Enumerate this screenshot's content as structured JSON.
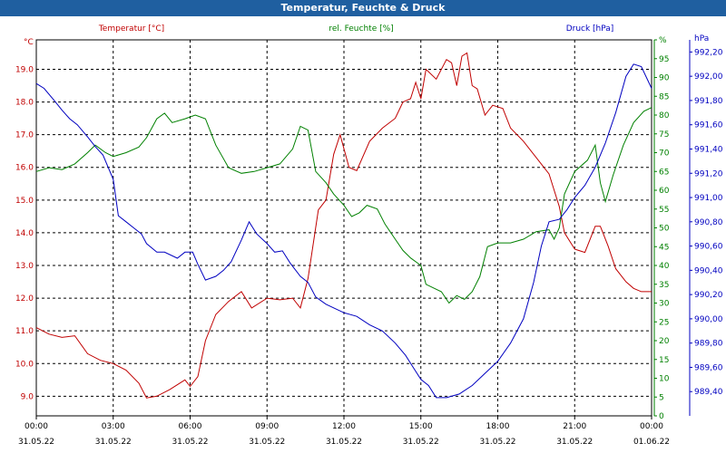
{
  "window": {
    "title": "Temperatur, Feuchte & Druck"
  },
  "colors": {
    "temperature": "#c00000",
    "humidity": "#008000",
    "pressure": "#0000c0",
    "title_bar": "#1f5fa0",
    "grid": "#000000"
  },
  "chart_data": {
    "type": "line",
    "grid": true,
    "x": {
      "ticks": [
        {
          "time": "00:00",
          "date": "31.05.22"
        },
        {
          "time": "03:00",
          "date": "31.05.22"
        },
        {
          "time": "06:00",
          "date": "31.05.22"
        },
        {
          "time": "09:00",
          "date": "31.05.22"
        },
        {
          "time": "12:00",
          "date": "31.05.22"
        },
        {
          "time": "15:00",
          "date": "31.05.22"
        },
        {
          "time": "18:00",
          "date": "31.05.22"
        },
        {
          "time": "21:00",
          "date": "31.05.22"
        },
        {
          "time": "00:00",
          "date": "01.06.22"
        }
      ]
    },
    "axes": {
      "left": {
        "unit": "°C",
        "ylim": [
          8.4,
          19.9
        ],
        "ticks": [
          "9.0",
          "10.0",
          "11.0",
          "12.0",
          "13.0",
          "14.0",
          "15.0",
          "16.0",
          "17.0",
          "18.0",
          "19.0"
        ]
      },
      "right1": {
        "unit": "%",
        "ylim": [
          0,
          100
        ],
        "ticks": [
          "0",
          "5",
          "10",
          "15",
          "20",
          "25",
          "30",
          "35",
          "40",
          "45",
          "50",
          "55",
          "60",
          "65",
          "70",
          "75",
          "80",
          "85",
          "90",
          "95",
          "%"
        ]
      },
      "right2": {
        "unit": "hPa",
        "ylim": [
          989.2,
          992.3
        ],
        "ticks": [
          "989,40",
          "989,60",
          "989,80",
          "990,00",
          "990,20",
          "990,40",
          "990,60",
          "990,80",
          "991,00",
          "991,20",
          "991,40",
          "991,60",
          "991,80",
          "992,00",
          "992,20",
          "hPa"
        ]
      }
    },
    "series": [
      {
        "name": "Temperatur [°C]",
        "axis": "left",
        "color": "#c00000",
        "points": [
          [
            0,
            11.1
          ],
          [
            0.5,
            10.9
          ],
          [
            1.0,
            10.8
          ],
          [
            1.5,
            10.85
          ],
          [
            2.0,
            10.3
          ],
          [
            2.5,
            10.1
          ],
          [
            3.0,
            10.0
          ],
          [
            3.5,
            9.8
          ],
          [
            4.0,
            9.4
          ],
          [
            4.3,
            8.95
          ],
          [
            4.7,
            9.0
          ],
          [
            5.2,
            9.2
          ],
          [
            5.8,
            9.5
          ],
          [
            6.0,
            9.3
          ],
          [
            6.3,
            9.6
          ],
          [
            6.6,
            10.7
          ],
          [
            7.0,
            11.5
          ],
          [
            7.5,
            11.9
          ],
          [
            8.0,
            12.2
          ],
          [
            8.4,
            11.7
          ],
          [
            9.0,
            12.0
          ],
          [
            9.5,
            11.95
          ],
          [
            10.0,
            12.0
          ],
          [
            10.3,
            11.7
          ],
          [
            10.6,
            12.6
          ],
          [
            11.0,
            14.7
          ],
          [
            11.3,
            15.0
          ],
          [
            11.6,
            16.4
          ],
          [
            11.85,
            17.0
          ],
          [
            12.2,
            16.0
          ],
          [
            12.5,
            15.9
          ],
          [
            13.0,
            16.8
          ],
          [
            13.5,
            17.2
          ],
          [
            14.0,
            17.5
          ],
          [
            14.3,
            18.0
          ],
          [
            14.6,
            18.1
          ],
          [
            14.8,
            18.6
          ],
          [
            15.0,
            18.1
          ],
          [
            15.2,
            19.0
          ],
          [
            15.6,
            18.7
          ],
          [
            16.0,
            19.3
          ],
          [
            16.2,
            19.2
          ],
          [
            16.4,
            18.5
          ],
          [
            16.6,
            19.4
          ],
          [
            16.8,
            19.5
          ],
          [
            17.0,
            18.5
          ],
          [
            17.2,
            18.4
          ],
          [
            17.5,
            17.6
          ],
          [
            17.8,
            17.9
          ],
          [
            18.2,
            17.8
          ],
          [
            18.5,
            17.2
          ],
          [
            19.0,
            16.8
          ],
          [
            19.5,
            16.3
          ],
          [
            20.0,
            15.8
          ],
          [
            20.4,
            14.8
          ],
          [
            20.6,
            14.0
          ],
          [
            21.0,
            13.5
          ],
          [
            21.4,
            13.4
          ],
          [
            21.8,
            14.2
          ],
          [
            22.0,
            14.2
          ],
          [
            22.3,
            13.6
          ],
          [
            22.6,
            12.9
          ],
          [
            23.0,
            12.5
          ],
          [
            23.3,
            12.3
          ],
          [
            23.6,
            12.2
          ],
          [
            24.0,
            12.2
          ]
        ]
      },
      {
        "name": "rel. Feuchte [%]",
        "axis": "right1",
        "color": "#008000",
        "points": [
          [
            0,
            65
          ],
          [
            0.5,
            66
          ],
          [
            1.0,
            65.5
          ],
          [
            1.5,
            67
          ],
          [
            2.0,
            70
          ],
          [
            2.3,
            72
          ],
          [
            2.7,
            70
          ],
          [
            3.0,
            69
          ],
          [
            3.5,
            70
          ],
          [
            4.0,
            71.5
          ],
          [
            4.3,
            74
          ],
          [
            4.7,
            79
          ],
          [
            5.0,
            80.5
          ],
          [
            5.3,
            78
          ],
          [
            5.8,
            79
          ],
          [
            6.2,
            80
          ],
          [
            6.6,
            79
          ],
          [
            7.0,
            72
          ],
          [
            7.5,
            66
          ],
          [
            8.0,
            64.5
          ],
          [
            8.5,
            65
          ],
          [
            9.0,
            66
          ],
          [
            9.5,
            67
          ],
          [
            10.0,
            71
          ],
          [
            10.3,
            77
          ],
          [
            10.6,
            76
          ],
          [
            10.9,
            65
          ],
          [
            11.3,
            62
          ],
          [
            11.6,
            59
          ],
          [
            12.0,
            56
          ],
          [
            12.3,
            53
          ],
          [
            12.6,
            54
          ],
          [
            12.9,
            56
          ],
          [
            13.3,
            55
          ],
          [
            13.6,
            51
          ],
          [
            14.0,
            47
          ],
          [
            14.3,
            44
          ],
          [
            14.6,
            42
          ],
          [
            15.0,
            40
          ],
          [
            15.2,
            35
          ],
          [
            15.5,
            34
          ],
          [
            15.8,
            33
          ],
          [
            16.1,
            30
          ],
          [
            16.4,
            32
          ],
          [
            16.7,
            31
          ],
          [
            17.0,
            33
          ],
          [
            17.3,
            37
          ],
          [
            17.6,
            45
          ],
          [
            18.0,
            46
          ],
          [
            18.5,
            46
          ],
          [
            19.0,
            47
          ],
          [
            19.5,
            49
          ],
          [
            20.0,
            49.5
          ],
          [
            20.2,
            47
          ],
          [
            20.4,
            50
          ],
          [
            20.6,
            59
          ],
          [
            21.0,
            65
          ],
          [
            21.5,
            68
          ],
          [
            21.8,
            72
          ],
          [
            22.0,
            62
          ],
          [
            22.2,
            57
          ],
          [
            22.5,
            64
          ],
          [
            22.9,
            72
          ],
          [
            23.3,
            78
          ],
          [
            23.7,
            81
          ],
          [
            24.0,
            82
          ]
        ]
      },
      {
        "name": "Druck [hPa]",
        "axis": "right2",
        "color": "#0000c0",
        "points": [
          [
            0,
            991.94
          ],
          [
            0.3,
            991.9
          ],
          [
            0.7,
            991.8
          ],
          [
            1.0,
            991.72
          ],
          [
            1.3,
            991.65
          ],
          [
            1.6,
            991.6
          ],
          [
            2.0,
            991.5
          ],
          [
            2.3,
            991.42
          ],
          [
            2.6,
            991.35
          ],
          [
            3.0,
            991.15
          ],
          [
            3.2,
            990.85
          ],
          [
            3.5,
            990.8
          ],
          [
            3.8,
            990.75
          ],
          [
            4.1,
            990.7
          ],
          [
            4.3,
            990.62
          ],
          [
            4.7,
            990.55
          ],
          [
            5.0,
            990.55
          ],
          [
            5.5,
            990.5
          ],
          [
            5.8,
            990.55
          ],
          [
            6.1,
            990.55
          ],
          [
            6.3,
            990.45
          ],
          [
            6.6,
            990.32
          ],
          [
            7.0,
            990.35
          ],
          [
            7.3,
            990.4
          ],
          [
            7.6,
            990.47
          ],
          [
            8.0,
            990.65
          ],
          [
            8.3,
            990.8
          ],
          [
            8.6,
            990.7
          ],
          [
            9.0,
            990.62
          ],
          [
            9.3,
            990.55
          ],
          [
            9.6,
            990.56
          ],
          [
            9.9,
            990.46
          ],
          [
            10.3,
            990.35
          ],
          [
            10.6,
            990.3
          ],
          [
            10.9,
            990.18
          ],
          [
            11.3,
            990.12
          ],
          [
            11.7,
            990.08
          ],
          [
            12.0,
            990.05
          ],
          [
            12.5,
            990.02
          ],
          [
            13.0,
            989.95
          ],
          [
            13.5,
            989.9
          ],
          [
            14.0,
            989.8
          ],
          [
            14.4,
            989.7
          ],
          [
            14.7,
            989.6
          ],
          [
            15.0,
            989.5
          ],
          [
            15.3,
            989.45
          ],
          [
            15.6,
            989.35
          ],
          [
            16.0,
            989.35
          ],
          [
            16.5,
            989.38
          ],
          [
            17.0,
            989.45
          ],
          [
            17.5,
            989.55
          ],
          [
            18.0,
            989.65
          ],
          [
            18.5,
            989.8
          ],
          [
            19.0,
            990.0
          ],
          [
            19.4,
            990.3
          ],
          [
            19.7,
            990.6
          ],
          [
            20.0,
            990.8
          ],
          [
            20.4,
            990.82
          ],
          [
            20.7,
            990.9
          ],
          [
            21.0,
            991.0
          ],
          [
            21.4,
            991.1
          ],
          [
            21.8,
            991.25
          ],
          [
            22.2,
            991.45
          ],
          [
            22.6,
            991.7
          ],
          [
            23.0,
            992.0
          ],
          [
            23.3,
            992.1
          ],
          [
            23.6,
            992.08
          ],
          [
            24.0,
            991.9
          ]
        ]
      }
    ]
  }
}
